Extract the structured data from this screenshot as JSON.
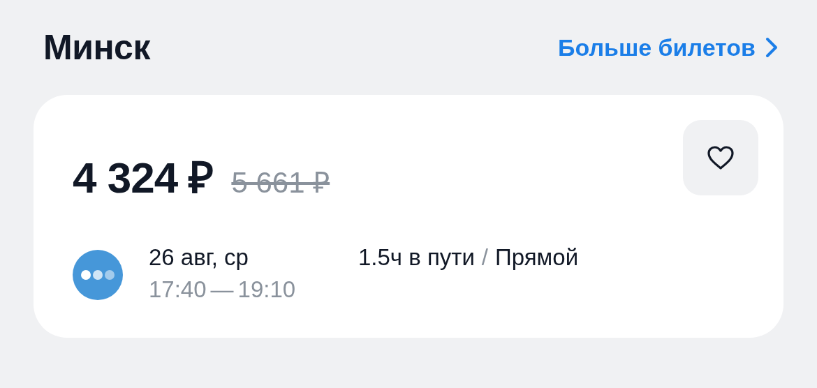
{
  "header": {
    "title": "Минск",
    "more_link": "Больше билетов"
  },
  "ticket": {
    "price": "4 324 ₽",
    "old_price": "5 661 ₽",
    "favorite": false,
    "date": "26 авг, ср",
    "departure": "17:40",
    "time_separator": "—",
    "arrival": "19:10",
    "duration": "1.5ч в пути",
    "separator": "/",
    "transfers": "Прямой"
  }
}
